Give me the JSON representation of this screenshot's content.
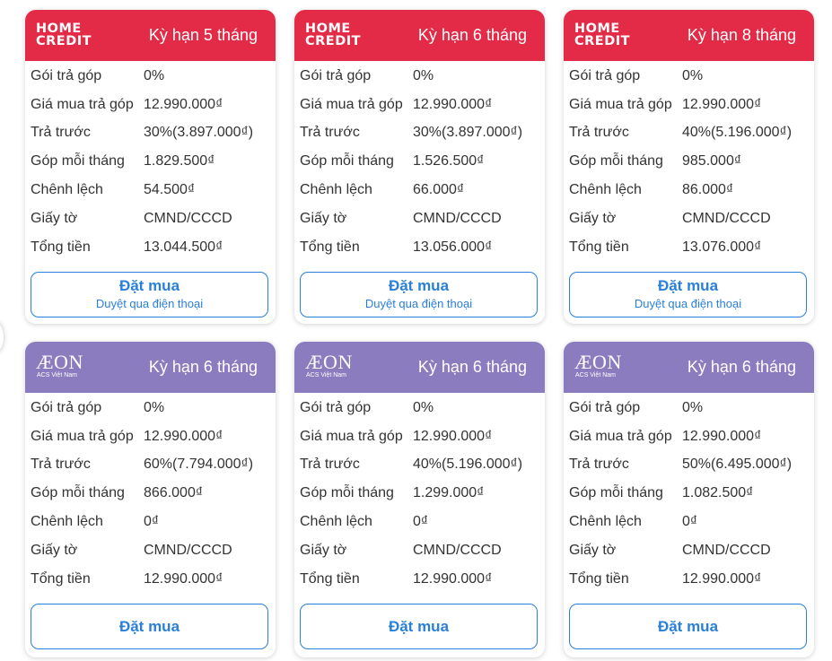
{
  "labels": {
    "goi": "Gói trả góp",
    "gia": "Giá mua trả góp",
    "tra_truoc": "Trả trước",
    "gop": "Góp mỗi tháng",
    "chenh": "Chênh lệch",
    "giay": "Giấy tờ",
    "tong": "Tổng tiền"
  },
  "logos": {
    "home_credit": {
      "line1": "HOME",
      "line2": "CREDIT",
      "color": "#e32a46"
    },
    "aeon": {
      "word": "ÆON",
      "sub": "ACS Việt Nam",
      "color": "#8a7cbf"
    }
  },
  "accent": "#2a7fd8",
  "cards": [
    {
      "provider": "home-credit",
      "term": "Kỳ hạn 5 tháng",
      "goi": "0%",
      "gia": "12.990.000₫",
      "tra_truoc": "30%(3.897.000₫)",
      "gop": "1.829.500₫",
      "chenh": "54.500₫",
      "giay": "CMND/CCCD",
      "tong": "13.044.500₫",
      "button": "Đặt mua",
      "button_sub": "Duyệt qua điện thoại"
    },
    {
      "provider": "home-credit",
      "term": "Kỳ hạn 6 tháng",
      "goi": "0%",
      "gia": "12.990.000₫",
      "tra_truoc": "30%(3.897.000₫)",
      "gop": "1.526.500₫",
      "chenh": "66.000₫",
      "giay": "CMND/CCCD",
      "tong": "13.056.000₫",
      "button": "Đặt mua",
      "button_sub": "Duyệt qua điện thoại"
    },
    {
      "provider": "home-credit",
      "term": "Kỳ hạn 8 tháng",
      "goi": "0%",
      "gia": "12.990.000₫",
      "tra_truoc": "40%(5.196.000₫)",
      "gop": "985.000₫",
      "chenh": "86.000₫",
      "giay": "CMND/CCCD",
      "tong": "13.076.000₫",
      "button": "Đặt mua",
      "button_sub": "Duyệt qua điện thoại"
    },
    {
      "provider": "aeon",
      "term": "Kỳ hạn 6 tháng",
      "goi": "0%",
      "gia": "12.990.000₫",
      "tra_truoc": "60%(7.794.000₫)",
      "gop": "866.000₫",
      "chenh": "0₫",
      "giay": "CMND/CCCD",
      "tong": "12.990.000₫",
      "button": "Đặt mua"
    },
    {
      "provider": "aeon",
      "term": "Kỳ hạn 6 tháng",
      "goi": "0%",
      "gia": "12.990.000₫",
      "tra_truoc": "40%(5.196.000₫)",
      "gop": "1.299.000₫",
      "chenh": "0₫",
      "giay": "CMND/CCCD",
      "tong": "12.990.000₫",
      "button": "Đặt mua"
    },
    {
      "provider": "aeon",
      "term": "Kỳ hạn 6 tháng",
      "goi": "0%",
      "gia": "12.990.000₫",
      "tra_truoc": "50%(6.495.000₫)",
      "gop": "1.082.500₫",
      "chenh": "0₫",
      "giay": "CMND/CCCD",
      "tong": "12.990.000₫",
      "button": "Đặt mua"
    }
  ]
}
